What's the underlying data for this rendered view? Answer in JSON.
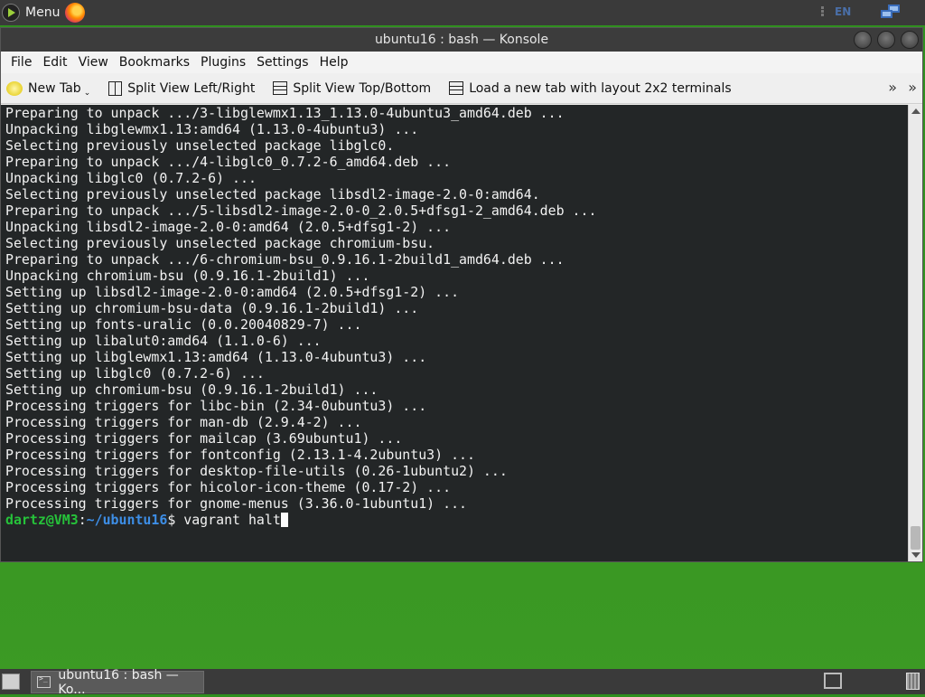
{
  "top_panel": {
    "menu_label": "Menu",
    "lang": "EN"
  },
  "window": {
    "title": "ubuntu16 : bash — Konsole",
    "menus": [
      "File",
      "Edit",
      "View",
      "Bookmarks",
      "Plugins",
      "Settings",
      "Help"
    ],
    "toolbar": {
      "new_tab": "New Tab",
      "split_lr": "Split View Left/Right",
      "split_tb": "Split View Top/Bottom",
      "layout_2x2": "Load a new tab with layout 2x2 terminals",
      "more": "»"
    }
  },
  "terminal": {
    "lines": [
      "Preparing to unpack .../3-libglewmx1.13_1.13.0-4ubuntu3_amd64.deb ...",
      "Unpacking libglewmx1.13:amd64 (1.13.0-4ubuntu3) ...",
      "Selecting previously unselected package libglc0.",
      "Preparing to unpack .../4-libglc0_0.7.2-6_amd64.deb ...",
      "Unpacking libglc0 (0.7.2-6) ...",
      "Selecting previously unselected package libsdl2-image-2.0-0:amd64.",
      "Preparing to unpack .../5-libsdl2-image-2.0-0_2.0.5+dfsg1-2_amd64.deb ...",
      "Unpacking libsdl2-image-2.0-0:amd64 (2.0.5+dfsg1-2) ...",
      "Selecting previously unselected package chromium-bsu.",
      "Preparing to unpack .../6-chromium-bsu_0.9.16.1-2build1_amd64.deb ...",
      "Unpacking chromium-bsu (0.9.16.1-2build1) ...",
      "Setting up libsdl2-image-2.0-0:amd64 (2.0.5+dfsg1-2) ...",
      "Setting up chromium-bsu-data (0.9.16.1-2build1) ...",
      "Setting up fonts-uralic (0.0.20040829-7) ...",
      "Setting up libalut0:amd64 (1.1.0-6) ...",
      "Setting up libglewmx1.13:amd64 (1.13.0-4ubuntu3) ...",
      "Setting up libglc0 (0.7.2-6) ...",
      "Setting up chromium-bsu (0.9.16.1-2build1) ...",
      "Processing triggers for libc-bin (2.34-0ubuntu3) ...",
      "Processing triggers for man-db (2.9.4-2) ...",
      "Processing triggers for mailcap (3.69ubuntu1) ...",
      "Processing triggers for fontconfig (2.13.1-4.2ubuntu3) ...",
      "Processing triggers for desktop-file-utils (0.26-1ubuntu2) ...",
      "Processing triggers for hicolor-icon-theme (0.17-2) ...",
      "Processing triggers for gnome-menus (3.36.0-1ubuntu1) ..."
    ],
    "prompt": {
      "user": "dartz@VM3",
      "path": "~/ubuntu16",
      "symbol": "$ ",
      "command": "vagrant halt"
    }
  },
  "taskbar": {
    "task_label": "ubuntu16 : bash — Ko..."
  }
}
